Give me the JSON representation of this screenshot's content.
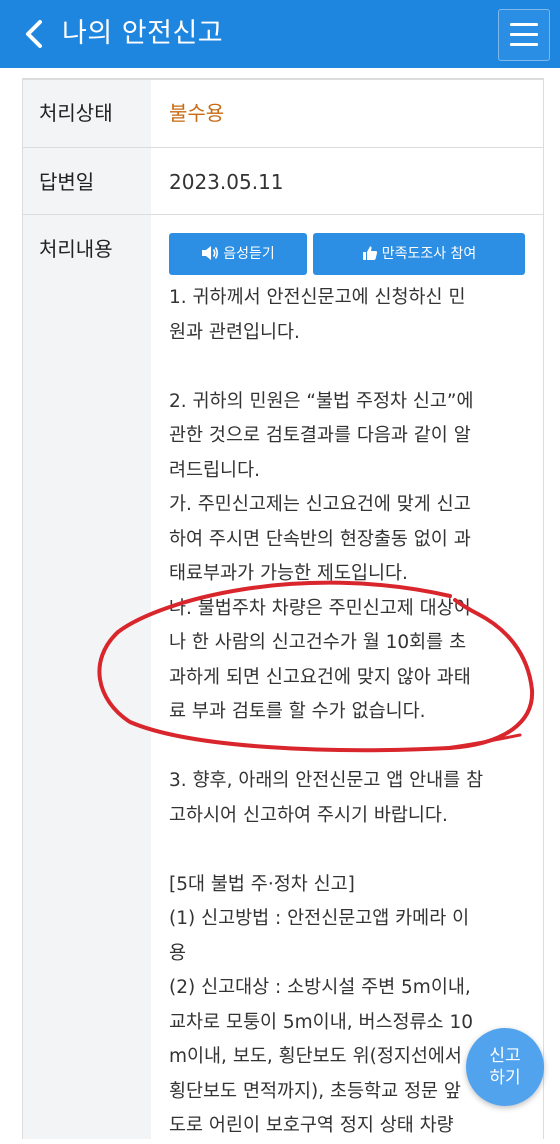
{
  "header": {
    "title": "나의 안전신고"
  },
  "details": {
    "status_label": "처리상태",
    "status_value": "불수용",
    "date_label": "답변일",
    "date_value": "2023.05.11",
    "content_label": "처리내용"
  },
  "buttons": {
    "voice": "음성듣기",
    "survey": "만족도조사 참여"
  },
  "content_lines": [
    "1. 귀하께서 안전신문고에 신청하신 민",
    "원과 관련입니다.",
    "",
    "2. 귀하의 민원은 “불법 주정차 신고”에",
    "관한 것으로 검토결과를 다음과 같이 알",
    "려드립니다.",
    "가. 주민신고제는 신고요건에 맞게 신고",
    "하여 주시면 단속반의 현장출동 없이 과",
    "태료부과가 가능한 제도입니다.",
    "나. 불법주차 차량은 주민신고제 대상이",
    "나 한 사람의 신고건수가 월 10회를 초",
    "과하게 되면 신고요건에 맞지 않아 과태",
    "료 부과 검토를 할 수가 없습니다.",
    "",
    "3. 향후, 아래의 안전신문고 앱 안내를 참",
    "고하시어 신고하여 주시기 바랍니다.",
    "",
    "[5대 불법 주·정차 신고]",
    "(1) 신고방법 : 안전신문고앱 카메라 이",
    "용",
    "(2) 신고대상 : 소방시설 주변 5m이내,",
    "교차로 모퉁이 5m이내, 버스정류소 10",
    "m이내, 보도, 횡단보도 위(정지선에서",
    "횡단보도 면적까지), 초등학교 정문 앞",
    "도로 어린이 보호구역 정지 상태 차량"
  ],
  "fab": {
    "line1": "신고",
    "line2": "하기"
  },
  "colors": {
    "header": "#1f86e0",
    "status": "#c76a12",
    "annotation": "#d8262c"
  }
}
